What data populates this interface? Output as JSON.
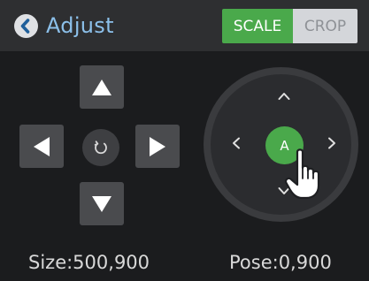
{
  "header": {
    "title": "Adjust",
    "tabs": [
      "SCALE",
      "CROP"
    ],
    "active_tab": "SCALE"
  },
  "icons": {
    "back": "back-arrow-circle-icon",
    "up": "triangle-up-icon",
    "down": "triangle-down-icon",
    "left": "triangle-left-icon",
    "right": "triangle-right-icon",
    "reset": "rotate-reset-icon",
    "joystick_up": "chevron-up-icon",
    "joystick_down": "chevron-down-icon",
    "joystick_left": "chevron-left-icon",
    "joystick_right": "chevron-right-icon",
    "pointer": "hand-pointer-icon"
  },
  "joystick": {
    "center_label": "A"
  },
  "footer": {
    "size": "Size:500,900",
    "pose": "Pose:0,900"
  },
  "colors": {
    "accent_green": "#4aa94b",
    "title_blue": "#8cc0ea",
    "background": "#1b1c1e"
  }
}
